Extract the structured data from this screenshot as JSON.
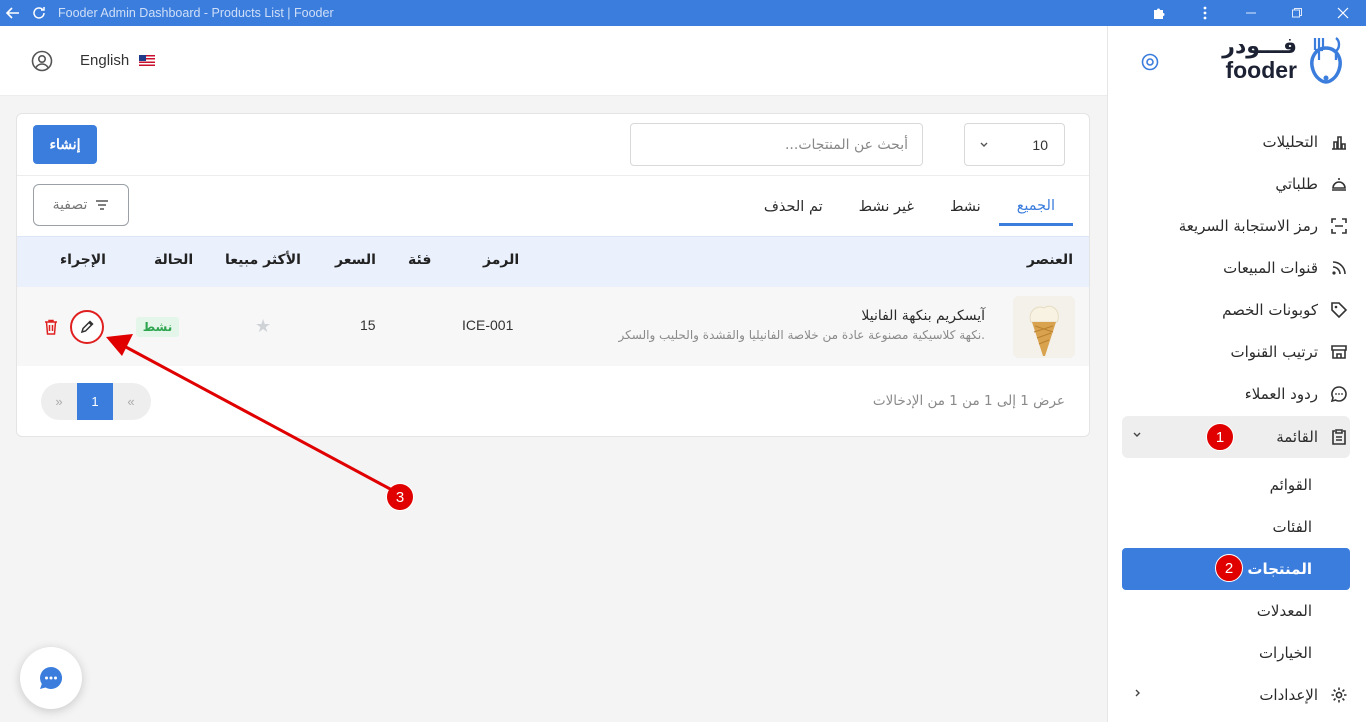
{
  "window": {
    "title": "Fooder Admin Dashboard - Products List | Fooder"
  },
  "brand": {
    "name_ar": "فـــودر",
    "name_en": "fooder"
  },
  "header": {
    "language": "English"
  },
  "sidebar": {
    "items": [
      {
        "label": "التحليلات",
        "icon": "chart-icon"
      },
      {
        "label": "طلباتي",
        "icon": "cloche-icon"
      },
      {
        "label": "رمز الاستجابة السريعة",
        "icon": "qr-scan-icon"
      },
      {
        "label": "قنوات المبيعات",
        "icon": "rss-icon"
      },
      {
        "label": "كوبونات الخصم",
        "icon": "tag-icon"
      },
      {
        "label": "ترتيب القنوات",
        "icon": "store-icon"
      },
      {
        "label": "ردود العملاء",
        "icon": "chat-bubble-icon"
      },
      {
        "label": "القائمة",
        "icon": "clipboard-icon"
      }
    ],
    "menu_sub": [
      "القوائم",
      "الفئات",
      "المنتجات",
      "المعدلات",
      "الخيارات"
    ],
    "settings": "الإعدادات"
  },
  "toolbar": {
    "create_label": "إنشاء",
    "search_placeholder": "أبحث عن المنتجات...",
    "per_page": "10",
    "filter_label": "تصفية"
  },
  "tabs": [
    "الجميع",
    "نشط",
    "غير نشط",
    "تم الحذف"
  ],
  "table": {
    "columns": {
      "item": "العنصر",
      "code": "الرمز",
      "category": "فئة",
      "price": "السعر",
      "bestseller": "الأكثر مبيعا",
      "status": "الحالة",
      "action": "الإجراء"
    },
    "rows": [
      {
        "name": "آيسكريم بنكهة الفانيلا",
        "description": "نكهة كلاسيكية مصنوعة عادة من خلاصة الفانيليا والقشدة والحليب والسكر.",
        "code": "ICE-001",
        "category": "",
        "price": "15",
        "status": "نشط"
      }
    ]
  },
  "pagination": {
    "info": "عرض 1 إلى 1 من 1 من الإدخالات",
    "prev": "«",
    "current": "1",
    "next": "»"
  },
  "annotations": {
    "one": "1",
    "two": "2",
    "three": "3"
  },
  "colors": {
    "primary": "#3b7ddd",
    "annotation": "#e00000",
    "status_green": "#2ea44f"
  }
}
